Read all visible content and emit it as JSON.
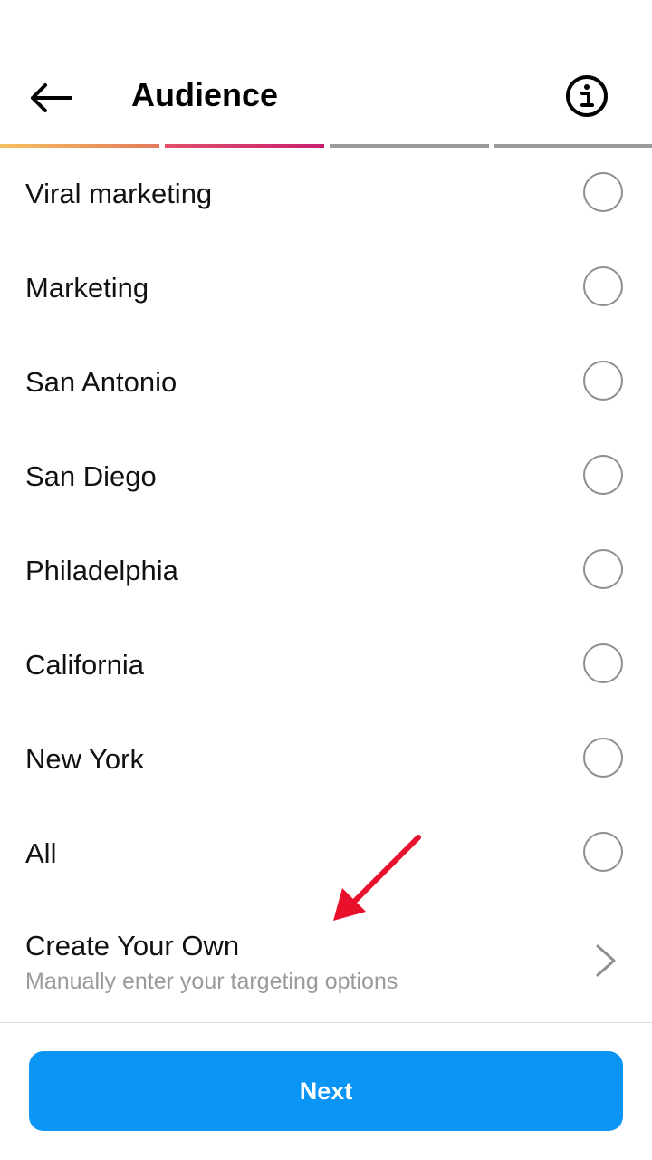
{
  "header": {
    "title": "Audience",
    "back_icon": "arrow-left-icon",
    "info_icon": "info-circle-icon"
  },
  "progress": {
    "total_steps": 4,
    "current_step": 2
  },
  "options": [
    {
      "label": "Viral marketing",
      "selected": false
    },
    {
      "label": "Marketing",
      "selected": false
    },
    {
      "label": "San Antonio",
      "selected": false
    },
    {
      "label": "San Diego",
      "selected": false
    },
    {
      "label": "Philadelphia",
      "selected": false
    },
    {
      "label": "California",
      "selected": false
    },
    {
      "label": "New York",
      "selected": false
    },
    {
      "label": "All",
      "selected": false
    }
  ],
  "custom": {
    "title": "Create Your Own",
    "subtitle": "Manually enter your targeting options",
    "icon": "chevron-right-icon"
  },
  "footer": {
    "next_label": "Next"
  },
  "colors": {
    "primary_button": "#0a95f5",
    "annotation_arrow": "#e8102a",
    "radio_border": "#8e8e8e"
  }
}
